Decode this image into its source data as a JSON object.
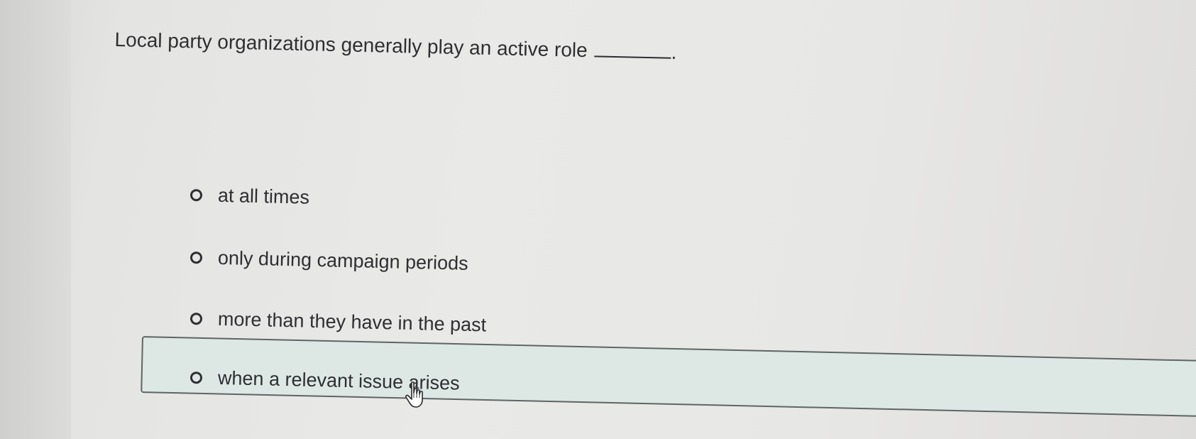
{
  "question": {
    "text": "Local party organizations generally play an active role",
    "end_punct": "."
  },
  "options": [
    {
      "label": "at all times",
      "selected": false,
      "highlighted": false
    },
    {
      "label": "only during campaign periods",
      "selected": false,
      "highlighted": false
    },
    {
      "label": "more than they have in the past",
      "selected": false,
      "highlighted": false
    },
    {
      "label": "when a relevant issue arises",
      "selected": false,
      "highlighted": true
    }
  ],
  "colors": {
    "text": "#2f2f33",
    "highlight_fill": "#dde8e4",
    "highlight_border": "#5f6566"
  },
  "cursor": {
    "icon": "hand-pointer-icon"
  }
}
